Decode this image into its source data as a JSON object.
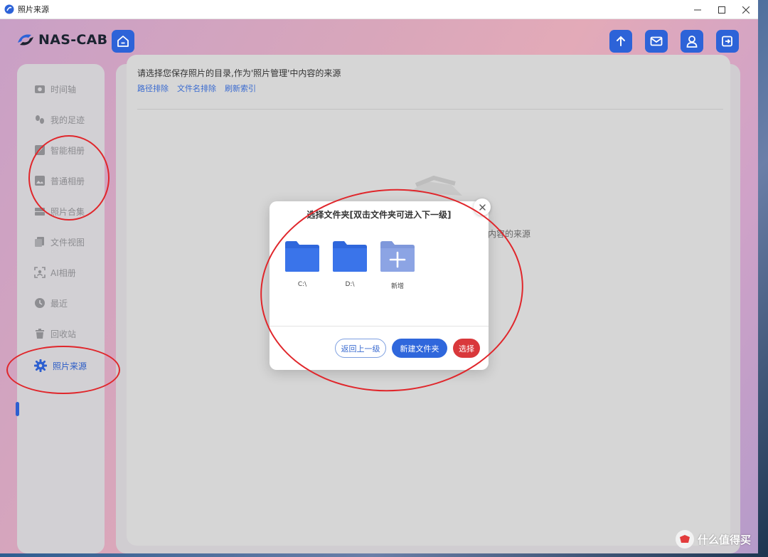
{
  "window": {
    "title": "照片来源"
  },
  "header": {
    "logo_text": "NAS-CAB",
    "home_icon": "home-icon",
    "actions": [
      {
        "icon": "upload-icon"
      },
      {
        "icon": "mail-icon"
      },
      {
        "icon": "user-icon"
      },
      {
        "icon": "logout-icon"
      }
    ]
  },
  "sidebar": {
    "items": [
      {
        "label": "时间轴",
        "icon": "camera-icon"
      },
      {
        "label": "我的足迹",
        "icon": "footprints-icon"
      },
      {
        "label": "智能相册",
        "icon": "smart-album-icon"
      },
      {
        "label": "普通相册",
        "icon": "image-icon"
      },
      {
        "label": "照片合集",
        "icon": "collection-icon"
      },
      {
        "label": "文件视图",
        "icon": "files-icon"
      },
      {
        "label": "AI相册",
        "icon": "ai-scan-icon"
      },
      {
        "label": "最近",
        "icon": "clock-icon"
      },
      {
        "label": "回收站",
        "icon": "trash-icon"
      },
      {
        "label": "照片来源",
        "icon": "gear-icon",
        "active": true
      }
    ]
  },
  "main": {
    "intro": "请选择您保存照片的目录,作为'照片管理'中内容的来源",
    "links": [
      "路径排除",
      "文件名排除",
      "刷新索引"
    ],
    "background_text": "内容的来源"
  },
  "dialog": {
    "title": "选择文件夹[双击文件夹可进入下一级]",
    "folders": [
      {
        "label": "C:\\"
      },
      {
        "label": "D:\\"
      },
      {
        "label": "新增"
      }
    ],
    "buttons": {
      "back": "返回上一级",
      "new_folder": "新建文件夹",
      "select": "选择"
    }
  },
  "watermark": {
    "text": "什么值得买"
  },
  "colors": {
    "accent": "#2d63d8",
    "danger": "#d9383b",
    "annotation": "#e0262b"
  }
}
